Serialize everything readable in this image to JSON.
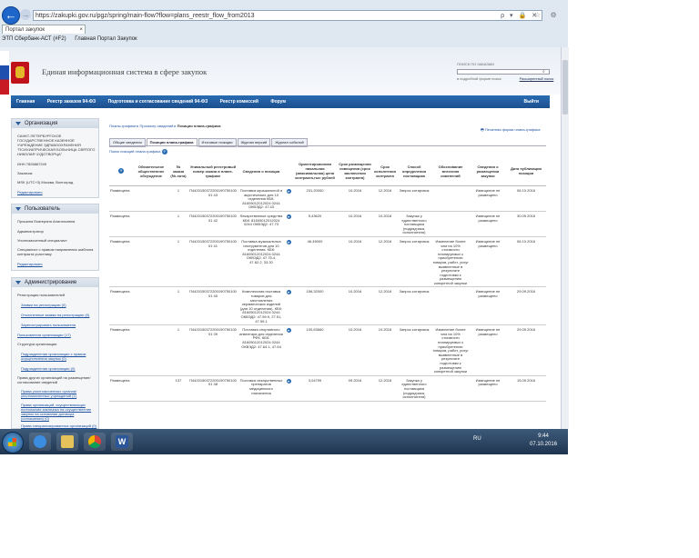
{
  "browser": {
    "url": "https://zakupki.gov.ru/pgz/spring/main-flow?flow=plans_reestr_flow_from2013",
    "url_controls": "ρ ▾ 🔒 ✕",
    "tab_title": "Портал закупок",
    "window_controls": "⌂ ☆ ⚙",
    "favorites": [
      "ЭТП Сбербанк-АСТ (#F2)",
      "Главная Портал Закупок"
    ]
  },
  "portal": {
    "title": "Единая информационная система в сфере закупок",
    "search_label": "ПОИСК ПО ЗАКАЗАМ",
    "search_option": "в подробной форме поиск",
    "search_extended": "Расширенный поиск"
  },
  "nav": [
    "Главная",
    "Реестр заказов 94-ФЗ",
    "Подготовка и согласование сведений 94-ФЗ",
    "Реестр комиссий",
    "Форум"
  ],
  "nav_exit": "Выйти",
  "sidebar": {
    "org": {
      "title": "Организация",
      "name": "САНКТ-ПЕТЕРБУРГСКОЕ ГОСУДАРСТВЕННОЕ КАЗЕННОЕ УЧРЕЖДЕНИЕ ЗДРАВООХРАНЕНИЯ \"ПСИХИАТРИЧЕСКАЯ БОЛЬНИЦА СВЯТОГО НИКОЛАЯ ЧУДОТВОРЦА\"",
      "inn": "ИНН 7826867249",
      "role": "Заказчик",
      "region": "МSK (UTC+3) Москва, Волгоград",
      "edit": "Редактировать"
    },
    "user": {
      "title": "Пользователь",
      "name": "Прошина Екатерина Анатольевна",
      "role1": "Администратор",
      "role2": "Уполномоченный специалист",
      "role3": "Специалист с правом направления шаблона контракта участнику",
      "edit": "Редактировать"
    },
    "admin": {
      "title": "Администрирование",
      "h1": "Регистрация пользователей",
      "l1": "Заявки на регистрацию (0)",
      "l2": "Отклоненные заявки на регистрацию (0)",
      "l3": "Зарегистрировать пользователя",
      "l4": "Пользователи организации (17)",
      "h2": "Структура организации",
      "l5": "Подразделения организации с правом осуществления закупок (0)",
      "l6": "Подразделения организации (0)",
      "h3": "Права других организаций на размещение/согласование сведений",
      "l7": "Права уполномоченных органов/ уполномоченных учреждений (1)",
      "l8": "Права организаций, осуществляющих полномочия заказчика на осуществление закупок на основании договора (соглашения) (0)",
      "l9": "Права специализированных организаций (0)"
    }
  },
  "content": {
    "breadcrumb": [
      "Планы-графики",
      "Просмотр сведений"
    ],
    "breadcrumb_current": "Позиции плана-графика",
    "print": "Печатная форма плана-графика",
    "tabs": [
      "Общие сведения",
      "Позиции плана-графика",
      "Итоговые позиции",
      "Журнал версий",
      "Журнал событий"
    ],
    "legend": "Поиск позиций плана-графика"
  },
  "table": {
    "headers": [
      "?",
      "Обязательное общественное обсуждение",
      "№ заказа (№ лота)",
      "Уникальный реестровый номер заказа в плане-графике",
      "Сведения о позиции",
      "",
      "Ориентировочная начальная (максимальная) цена контракта,тыс рублей",
      "Срок размещения извещения (срок заключения контракта)",
      "Срок исполнения контракта",
      "Способ определения поставщика",
      "Обоснование внесения изменений",
      "Сведения о размещении закупки",
      "Дата публикации позиции"
    ],
    "rows": [
      {
        "status": "Размещена",
        "num": "1",
        "reg": "П442015037220019075010001 43",
        "info": "Поставка музыкальной и акустических для 10 отделения КБК: 81605012012024 0244 ОКВЭД2: 47.43",
        "price": "231,20000",
        "deadline": "10.2016",
        "exec": "12.2016",
        "method": "Запрос котировок",
        "reason": "",
        "placement": "Извещение не размещено",
        "date": "06.10.2016"
      },
      {
        "status": "Размещена",
        "num": "1",
        "reg": "П442015037220019075010001 42",
        "info": "Лекарственные средства КБК: 81605012012024 0244 ОКВЭД2: 47.73",
        "price": "5,43620",
        "deadline": "10.2016",
        "exec": "10.2016",
        "method": "Закупка у единственного поставщика (подрядчика, исполнителя)",
        "reason": "",
        "placement": "Извещение не размещено",
        "date": "30.09.2016"
      },
      {
        "status": "Размещена",
        "num": "1",
        "reg": "П442015037220019075010001 41",
        "info": "Поставка музыкальных инструментов для 10 отделения. КБК: 81605012012024 0244 ОКВЭД2: 47.75.4, 47.82.2, 33.20",
        "price": "46,45000",
        "deadline": "10.2016",
        "exec": "12.2016",
        "method": "Запрос котировок",
        "reason": "Изменение более чем на 10% стоимости планируемых к приобретению товаров, работ, услуг выявленные в результате подготовки к размещению конкретной закупки",
        "placement": "Извещение не размещено",
        "date": "06.10.2016"
      },
      {
        "status": "Размещена",
        "num": "1",
        "reg": "П442015037220019075010001 40",
        "info": "Комплексная поставка товаров для заготовления керамических изделий (для 10 отделения). КБК: 81605012012024 0244 ОКВЭД2: 47.59.9, 27.51, 47.59.1",
        "price": "156,32000",
        "deadline": "10.2016",
        "exec": "12.2016",
        "method": "Запрос котировок",
        "reason": "",
        "placement": "Извещение не размещено",
        "date": "29.09.2016"
      },
      {
        "status": "Размещена",
        "num": "1",
        "reg": "П442015037220019075010001 39",
        "info": "Поставка спортивного инвентаря для отделения РФК. КБК: 81605012012024 0244 ОКВЭД2: 47.64.1, 47.64",
        "price": "100,63660",
        "deadline": "10.2016",
        "exec": "10.2016",
        "method": "Запрос котировок",
        "reason": "Изменение более чем на 10% стоимости планируемых к приобретению товаров, работ, услуг выявленные в результате подготовки к размещению конкретной закупки",
        "placement": "Извещение не размещено",
        "date": "29.09.2016"
      },
      {
        "status": "Размещена",
        "num": "137",
        "reg": "П442015037220019075010001 38",
        "info": "Поставка лекарственных препаратов медицинского назначения",
        "price": "3,04799",
        "deadline": "09.2016",
        "exec": "12.2016",
        "method": "Закупка у единственного поставщика (подрядчика, исполнителя)",
        "reason": "",
        "placement": "Извещение не размещено",
        "date": "15.09.2016"
      }
    ]
  },
  "taskbar": {
    "lang": "RU",
    "time": "9:44",
    "date": "07.10.2016"
  }
}
